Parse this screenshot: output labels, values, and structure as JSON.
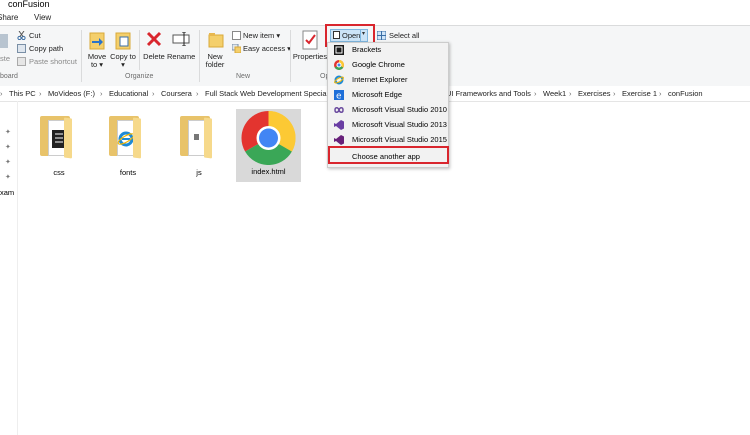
{
  "window": {
    "title": "conFusion"
  },
  "tabs": [
    "Share",
    "View"
  ],
  "ribbon": {
    "clipboard": {
      "cut": "Cut",
      "copy_path": "Copy path",
      "paste_shortcut": "Paste shortcut",
      "group": "board",
      "paste_partial": "ste"
    },
    "organize": {
      "move_to": "Move to ▾",
      "copy_to": "Copy to ▾",
      "delete": "Delete",
      "rename": "Rename",
      "group": "Organize"
    },
    "new": {
      "new_folder": "New folder",
      "new_item": "New item ▾",
      "easy_access": "Easy access ▾",
      "group": "New"
    },
    "open": {
      "properties": "Properties",
      "open": "Open",
      "group_partial": "Op",
      "select_all": "Select all"
    }
  },
  "address": {
    "crumbs": [
      "This PC",
      "MoVideos (F:)",
      "Educational",
      "Coursera",
      "Full Stack Web Development Specializ",
      "UI Frameworks and Tools",
      "Week1",
      "Exercises",
      "Exercise 1",
      "conFusion"
    ]
  },
  "nav": {
    "partial_label": "xam"
  },
  "files": [
    {
      "name": "css"
    },
    {
      "name": "fonts"
    },
    {
      "name": "js"
    },
    {
      "name": "index.html"
    }
  ],
  "open_menu": {
    "items": [
      {
        "label": "Brackets",
        "icon": "brackets-icon"
      },
      {
        "label": "Google Chrome",
        "icon": "chrome-icon"
      },
      {
        "label": "Internet Explorer",
        "icon": "ie-icon"
      },
      {
        "label": "Microsoft Edge",
        "icon": "edge-icon"
      },
      {
        "label": "Microsoft Visual Studio 2010",
        "icon": "vs2010-icon"
      },
      {
        "label": "Microsoft Visual Studio 2013",
        "icon": "vs2013-icon"
      },
      {
        "label": "Microsoft Visual Studio 2015",
        "icon": "vs2015-icon"
      }
    ],
    "choose_another": "Choose another app"
  },
  "colors": {
    "highlight": "#d9262e",
    "selected_file_bg": "#cce8ff",
    "folder": "#f6d98b"
  }
}
